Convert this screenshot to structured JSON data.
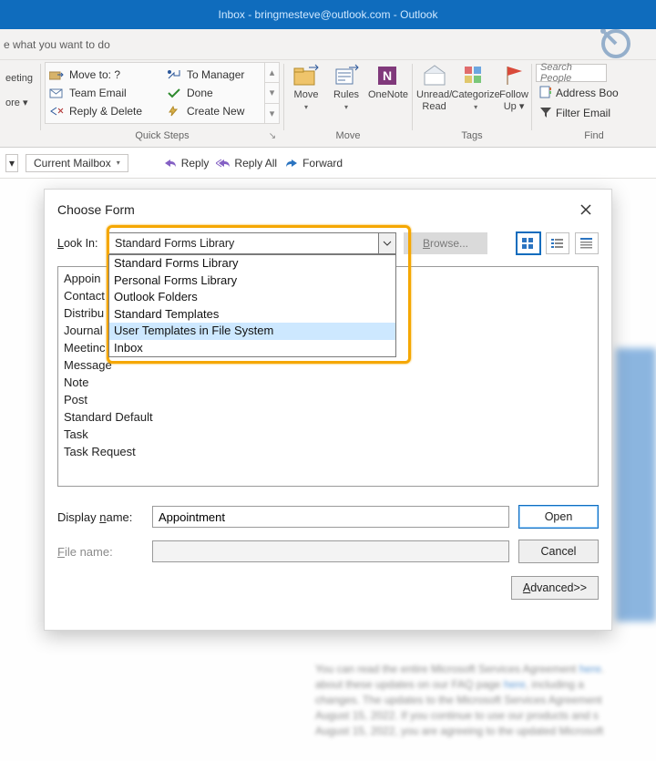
{
  "titlebar": {
    "text": "Inbox - bringmesteve@outlook.com  -  Outlook"
  },
  "tellme": {
    "text": "e what you want to do"
  },
  "ribbon": {
    "meeting": {
      "label": "eeting",
      "more": "ore ▾"
    },
    "quicksteps": {
      "group_label": "Quick Steps",
      "items": [
        {
          "label": "Move to: ?"
        },
        {
          "label": "To Manager"
        },
        {
          "label": "Team Email"
        },
        {
          "label": "Done"
        },
        {
          "label": "Reply & Delete"
        },
        {
          "label": "Create New"
        }
      ]
    },
    "move": {
      "group_label": "Move",
      "move_label": "Move",
      "rules_label": "Rules",
      "onenote_label": "OneNote"
    },
    "tags": {
      "group_label": "Tags",
      "unread_label": "Unread/\nRead",
      "categorize_label": "Categorize",
      "followup_label": "Follow\nUp ▾"
    },
    "find": {
      "group_label": "Find",
      "search_placeholder": "Search People",
      "address_book": "Address Boo",
      "filter": "Filter Email"
    }
  },
  "subbar": {
    "dropdown": "▾",
    "mailbox": "Current Mailbox",
    "reply": "Reply",
    "reply_all": "Reply All",
    "forward": "Forward"
  },
  "dialog": {
    "title": "Choose Form",
    "look_in_label": "Look In:",
    "look_in_value": "Standard Forms Library",
    "browse": "Browse...",
    "dropdown_options": [
      "Standard Forms Library",
      "Personal Forms Library",
      "Outlook Folders",
      "Standard Templates",
      "User Templates in File System",
      "Inbox"
    ],
    "selected_option_index": 4,
    "forms": [
      "Appoin",
      "Contact",
      "Distribu",
      "Journal E",
      "Meetinc",
      "Message",
      "Note",
      "Post",
      "Standard Default",
      "Task",
      "Task Request"
    ],
    "display_name_label": "Display name:",
    "display_name_value": "Appointment",
    "file_name_label": "File name:",
    "open": "Open",
    "cancel": "Cancel",
    "advanced": "Advanced>>"
  }
}
